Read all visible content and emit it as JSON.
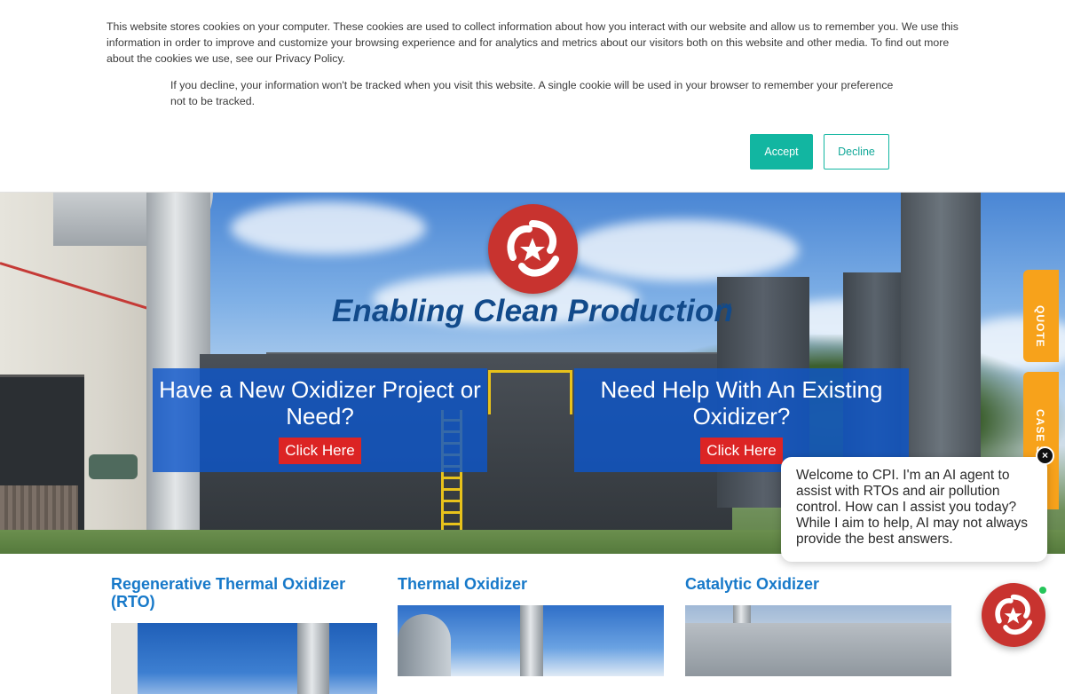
{
  "cookie_banner": {
    "message": "This website stores cookies on your computer. These cookies are used to collect information about how you interact with our website and allow us to remember you. We use this information in order to improve and customize your browsing experience and for analytics and metrics about our visitors both on this website and other media. To find out more about the cookies we use, see our Privacy Policy.",
    "decline_note": "If you decline, your information won't be tracked when you visit this website. A single cookie will be used in your browser to remember your preference not to be tracked.",
    "accept_label": "Accept",
    "decline_label": "Decline"
  },
  "hero": {
    "tagline": "Enabling Clean Production",
    "trademark": "™",
    "cta_left": {
      "title": "Have a New Oxidizer Project or Need?",
      "button": "Click Here"
    },
    "cta_right": {
      "title": "Need Help With An Existing Oxidizer?",
      "button": "Click Here"
    }
  },
  "side_tabs": {
    "quote": "QUOTE",
    "case": "CASE S"
  },
  "products": [
    {
      "title": "Regenerative Thermal Oxidizer (RTO)"
    },
    {
      "title": "Thermal Oxidizer"
    },
    {
      "title": "Catalytic Oxidizer"
    }
  ],
  "chat": {
    "message": "Welcome to CPI. I'm an AI agent to assist with RTOs and air pollution control. How can I assist you today? While I aim to help, AI may not always provide the best answers.",
    "close_symbol": "×"
  },
  "colors": {
    "accept_button": "#12b6a1",
    "brand_blue": "#124a8a",
    "cta_button": "#dc2424",
    "side_tab": "#f7a21b",
    "product_title": "#1779c9",
    "logo_red": "#c8332f"
  }
}
